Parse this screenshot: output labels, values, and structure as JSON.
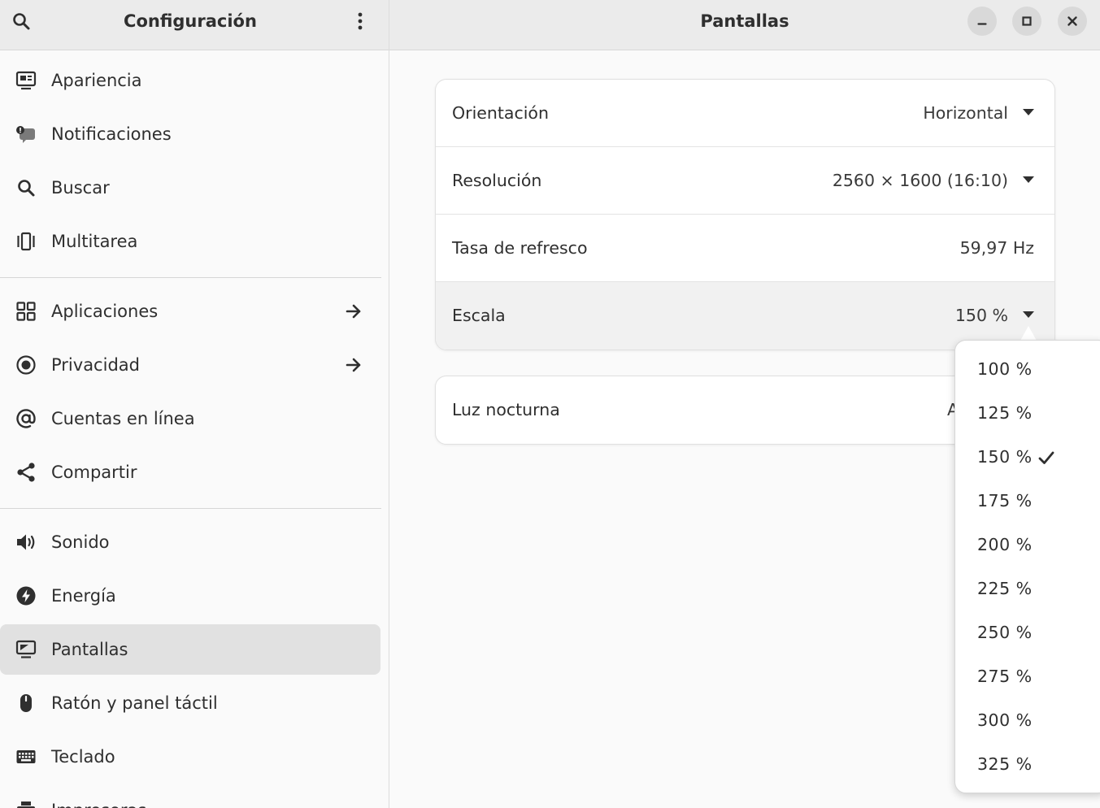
{
  "sidebar": {
    "title": "Configuración",
    "search_icon": "search-icon",
    "menu_icon": "vertical-dots-menu-icon",
    "items": [
      {
        "label": "Apariencia",
        "icon": "appearance-icon"
      },
      {
        "label": "Notificaciones",
        "icon": "notifications-icon"
      },
      {
        "label": "Buscar",
        "icon": "search-icon"
      },
      {
        "label": "Multitarea",
        "icon": "multitasking-icon"
      },
      {
        "label": "Aplicaciones",
        "icon": "apps-grid-icon",
        "arrow": true
      },
      {
        "label": "Privacidad",
        "icon": "privacy-icon",
        "arrow": true
      },
      {
        "label": "Cuentas en línea",
        "icon": "at-sign-icon"
      },
      {
        "label": "Compartir",
        "icon": "share-icon"
      },
      {
        "label": "Sonido",
        "icon": "speaker-icon"
      },
      {
        "label": "Energía",
        "icon": "power-bolt-icon"
      },
      {
        "label": "Pantallas",
        "icon": "display-icon",
        "selected": true
      },
      {
        "label": "Ratón y panel táctil",
        "icon": "mouse-icon"
      },
      {
        "label": "Teclado",
        "icon": "keyboard-icon"
      },
      {
        "label": "Impresoras",
        "icon": "printer-icon"
      }
    ]
  },
  "main": {
    "title": "Pantallas",
    "window_controls": [
      "minimize-icon",
      "maximize-icon",
      "close-icon"
    ],
    "display_settings": [
      {
        "label": "Orientación",
        "value": "Horizontal",
        "dropdown": true
      },
      {
        "label": "Resolución",
        "value": "2560 × 1600 (16:10)",
        "dropdown": true
      },
      {
        "label": "Tasa de refresco",
        "value": "59,97 Hz",
        "dropdown": false
      },
      {
        "label": "Escala",
        "value": "150 %",
        "dropdown": true,
        "active": true
      }
    ],
    "night_light": {
      "label": "Luz nocturna",
      "value": "Ap"
    }
  },
  "scale_popover": {
    "options": [
      "100 %",
      "125 %",
      "150 %",
      "175 %",
      "200 %",
      "225 %",
      "250 %",
      "275 %",
      "300 %",
      "325 %"
    ],
    "selected": "150 %"
  },
  "colors": {
    "header_bg": "#ebebeb",
    "window_bg": "#fafafa",
    "selected_bg": "#e1e1e1",
    "text": "#2f2f2f"
  }
}
